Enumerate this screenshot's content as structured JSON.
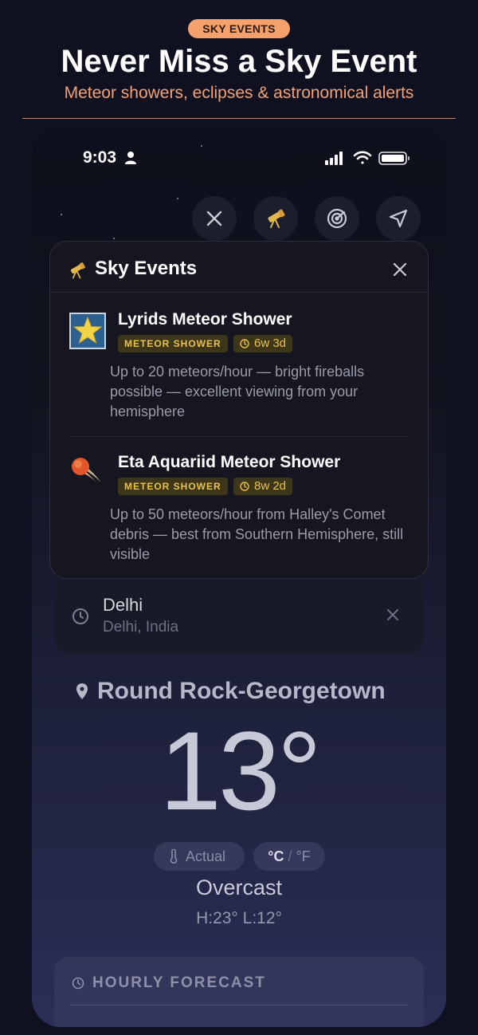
{
  "promo": {
    "badge": "SKY EVENTS",
    "title": "Never Miss a Sky Event",
    "subtitle": "Meteor showers, eclipses & astronomical alerts"
  },
  "status_bar": {
    "time": "9:03",
    "icons": [
      "person-icon",
      "cellular-signal-icon",
      "wifi-icon",
      "battery-icon"
    ]
  },
  "toolbar": {
    "buttons": [
      "close-icon",
      "telescope-icon",
      "radar-icon",
      "navigation-arrow-icon"
    ]
  },
  "sky_events": {
    "title": "Sky Events",
    "events": [
      {
        "icon": "star-icon",
        "title": "Lyrids Meteor Shower",
        "tag": "METEOR SHOWER",
        "countdown": "6w 3d",
        "description": "Up to 20 meteors/hour — bright fireballs possible — excellent viewing from your hemisphere"
      },
      {
        "icon": "comet-icon",
        "title": "Eta Aquariid Meteor Shower",
        "tag": "METEOR SHOWER",
        "countdown": "8w 2d",
        "description": "Up to 50 meteors/hour from Halley's Comet debris — best from Southern Hemisphere, still visible"
      }
    ]
  },
  "recent_location": {
    "city": "Delhi",
    "region": "Delhi, India"
  },
  "weather": {
    "location": "Round Rock-Georgetown",
    "temperature": "13°",
    "actual_label": "Actual",
    "unit_c": "°C",
    "unit_sep": "/",
    "unit_f": "°F",
    "condition": "Overcast",
    "hilo": "H:23°  L:12°"
  },
  "hourly": {
    "title": "HOURLY FORECAST"
  },
  "colors": {
    "accent_orange": "#f6a06b",
    "tag_text": "#e8c14a",
    "tag_bg": "#3e3618"
  }
}
